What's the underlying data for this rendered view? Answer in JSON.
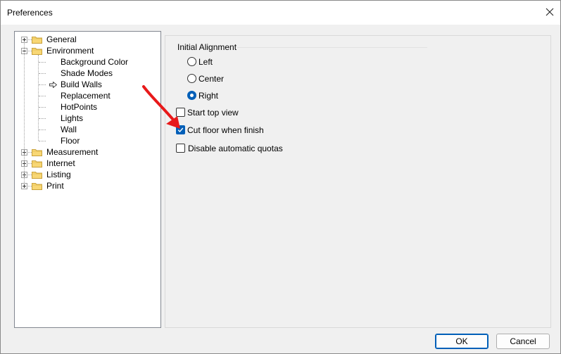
{
  "window": {
    "title": "Preferences",
    "close_icon": "close-icon"
  },
  "tree": {
    "items": [
      {
        "label": "General",
        "type": "folder",
        "expanded": false
      },
      {
        "label": "Environment",
        "type": "folder",
        "expanded": true
      },
      {
        "label": "Background Color",
        "type": "child"
      },
      {
        "label": "Shade Modes",
        "type": "child"
      },
      {
        "label": "Build Walls",
        "type": "child",
        "selected": true
      },
      {
        "label": "Replacement",
        "type": "child"
      },
      {
        "label": "HotPoints",
        "type": "child"
      },
      {
        "label": "Lights",
        "type": "child"
      },
      {
        "label": "Wall",
        "type": "child"
      },
      {
        "label": "Floor",
        "type": "child"
      },
      {
        "label": "Measurement",
        "type": "folder",
        "expanded": false
      },
      {
        "label": "Internet",
        "type": "folder",
        "expanded": false
      },
      {
        "label": "Listing",
        "type": "folder",
        "expanded": false
      },
      {
        "label": "Print",
        "type": "folder",
        "expanded": false
      }
    ]
  },
  "panel": {
    "group_label": "Initial Alignment",
    "alignment": {
      "options": [
        "Left",
        "Center",
        "Right"
      ],
      "selected": "Right"
    },
    "checkboxes": [
      {
        "label": "Start top view",
        "checked": false
      },
      {
        "label": "Cut floor when finish",
        "checked": true
      },
      {
        "label": "Disable automatic quotas",
        "checked": false
      }
    ]
  },
  "buttons": {
    "ok": "OK",
    "cancel": "Cancel"
  },
  "colors": {
    "accent": "#005fb8",
    "annotation_arrow": "#e8191a"
  }
}
